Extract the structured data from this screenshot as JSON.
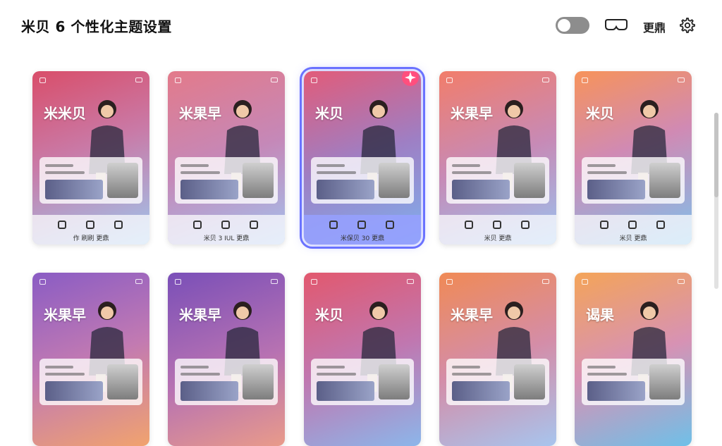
{
  "header": {
    "title": "米贝 6 个性化主题设置",
    "more_label": "更鼎"
  },
  "themes": [
    {
      "brand": "米米贝",
      "dock_label": "作 刷刷 更鼎",
      "bg": "linear-gradient(160deg,#d94e6a 0%,#c97aa7 45%,#9ec7ee 100%)",
      "selected": false
    },
    {
      "brand": "米果早",
      "dock_label": "米贝 3 IUL 更鼎",
      "bg": "linear-gradient(160deg,#e37a8a 0%,#c588b8 50%,#a3c2ee 100%)",
      "selected": false
    },
    {
      "brand": "米贝",
      "dock_label": "米保贝 30 更鼎",
      "bg": "linear-gradient(160deg,#e25b79 0%,#9e7fc4 50%,#7fb0ee 100%)",
      "selected": true
    },
    {
      "brand": "米果早",
      "dock_label": "米贝 更鼎",
      "bg": "linear-gradient(160deg,#f27d6a 0%,#c78ab6 50%,#9ac3f0 100%)",
      "selected": false
    },
    {
      "brand": "米贝",
      "dock_label": "米贝 更鼎",
      "bg": "linear-gradient(160deg,#f7935a 0%,#d08ab4 45%,#7ec1ec 100%)",
      "selected": false
    },
    {
      "brand": "米果早",
      "dock_label": "",
      "bg": "linear-gradient(160deg,#8a5cc4 0%,#c27ab2 50%,#f1a36e 100%)",
      "selected": false
    },
    {
      "brand": "米果早",
      "dock_label": "",
      "bg": "linear-gradient(160deg,#7a4fb8 0%,#b772b2 55%,#e99b8a 100%)",
      "selected": false
    },
    {
      "brand": "米贝",
      "dock_label": "",
      "bg": "linear-gradient(160deg,#e2586e 0%,#c077b0 50%,#8cb6ea 100%)",
      "selected": false
    },
    {
      "brand": "米果早",
      "dock_label": "",
      "bg": "linear-gradient(160deg,#f08a55 0%,#d48da8 50%,#a7c5ee 100%)",
      "selected": false
    },
    {
      "brand": "谒果",
      "dock_label": "",
      "bg": "linear-gradient(160deg,#f4a458 0%,#d792b4 50%,#6fc0e8 100%)",
      "selected": false
    }
  ],
  "icons": {
    "toggle": "toggle-switch",
    "vr": "vr-headset-icon",
    "settings": "gear-icon"
  }
}
